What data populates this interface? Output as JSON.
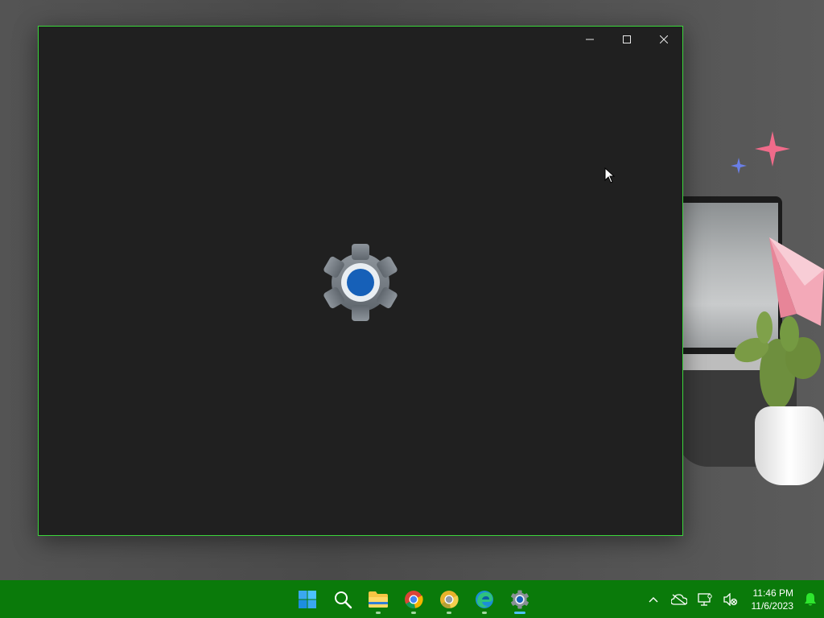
{
  "window": {
    "controls": [
      {
        "name": "minimize-button",
        "icon": "minimize-icon"
      },
      {
        "name": "maximize-button",
        "icon": "maximize-icon"
      },
      {
        "name": "close-button",
        "icon": "close-icon"
      }
    ],
    "splash_icon": "settings-gear-icon",
    "border_color": "#3bd63b",
    "background": "#202020"
  },
  "taskbar": {
    "background": "#0a7a0a",
    "apps": [
      {
        "name": "start",
        "icon": "windows-logo-icon",
        "running": false
      },
      {
        "name": "search",
        "icon": "search-icon",
        "running": false
      },
      {
        "name": "file-explorer",
        "icon": "folder-icon",
        "running": true
      },
      {
        "name": "chrome",
        "icon": "chrome-icon",
        "running": true
      },
      {
        "name": "chrome-canary",
        "icon": "chrome-canary-icon",
        "running": true
      },
      {
        "name": "edge",
        "icon": "edge-icon",
        "running": true
      },
      {
        "name": "settings",
        "icon": "settings-gear-icon",
        "running": true,
        "active": true
      }
    ],
    "tray": {
      "icons": [
        "chevron-up-icon",
        "onedrive-offline-icon",
        "network-icon",
        "speaker-muted-icon"
      ],
      "time": "11:46 PM",
      "date": "11/6/2023",
      "notification_icon": "notification-bell-icon"
    }
  }
}
